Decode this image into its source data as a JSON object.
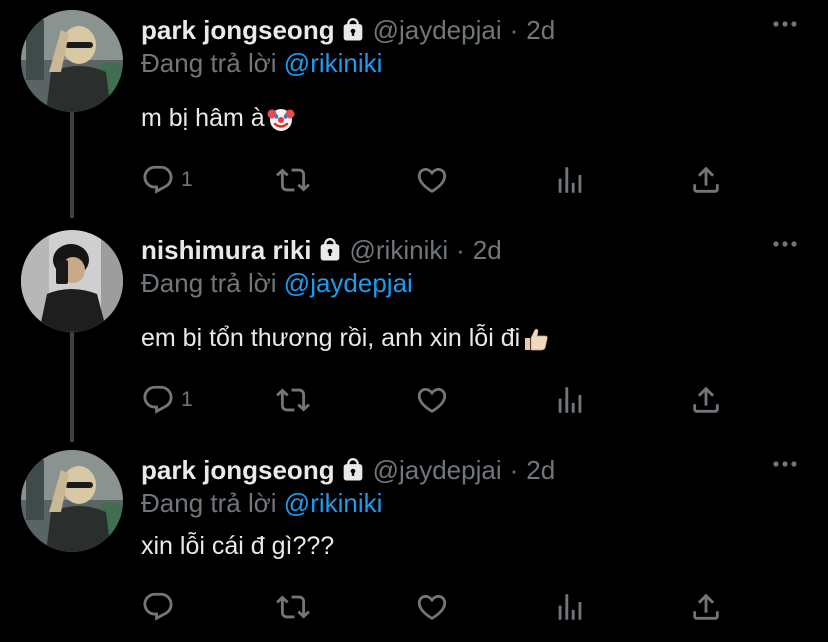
{
  "tweets": [
    {
      "name": "park jongseong",
      "handle": "@jaydepjai",
      "separator": "·",
      "time": "2d",
      "reply_prefix": "Đang trả lời",
      "reply_to": "@rikiniki",
      "text": "m bị hâm à",
      "emoji": "clown-face",
      "reply_count": "1",
      "avatar": "avatar-jongseong"
    },
    {
      "name": "nishimura riki",
      "handle": "@rikiniki",
      "separator": "·",
      "time": "2d",
      "reply_prefix": "Đang trả lời",
      "reply_to": "@jaydepjai",
      "text": "em bị tổn thương rồi, anh xin lỗi đi",
      "emoji": "thumbs-up",
      "reply_count": "1",
      "avatar": "avatar-riki"
    },
    {
      "name": "park jongseong",
      "handle": "@jaydepjai",
      "separator": "·",
      "time": "2d",
      "reply_prefix": "Đang trả lời",
      "reply_to": "@rikiniki",
      "text": "xin lỗi cái đ gì???",
      "emoji": "",
      "reply_count": "",
      "avatar": "avatar-jongseong"
    }
  ],
  "icons": [
    "lock-icon",
    "more-icon",
    "reply-icon",
    "retweet-icon",
    "like-icon",
    "analytics-icon",
    "share-icon"
  ],
  "colors": {
    "background": "#000000",
    "text": "#e7e9ea",
    "secondary": "#71767b",
    "mention": "#1d9bf0",
    "thread_line": "#3e4144"
  }
}
